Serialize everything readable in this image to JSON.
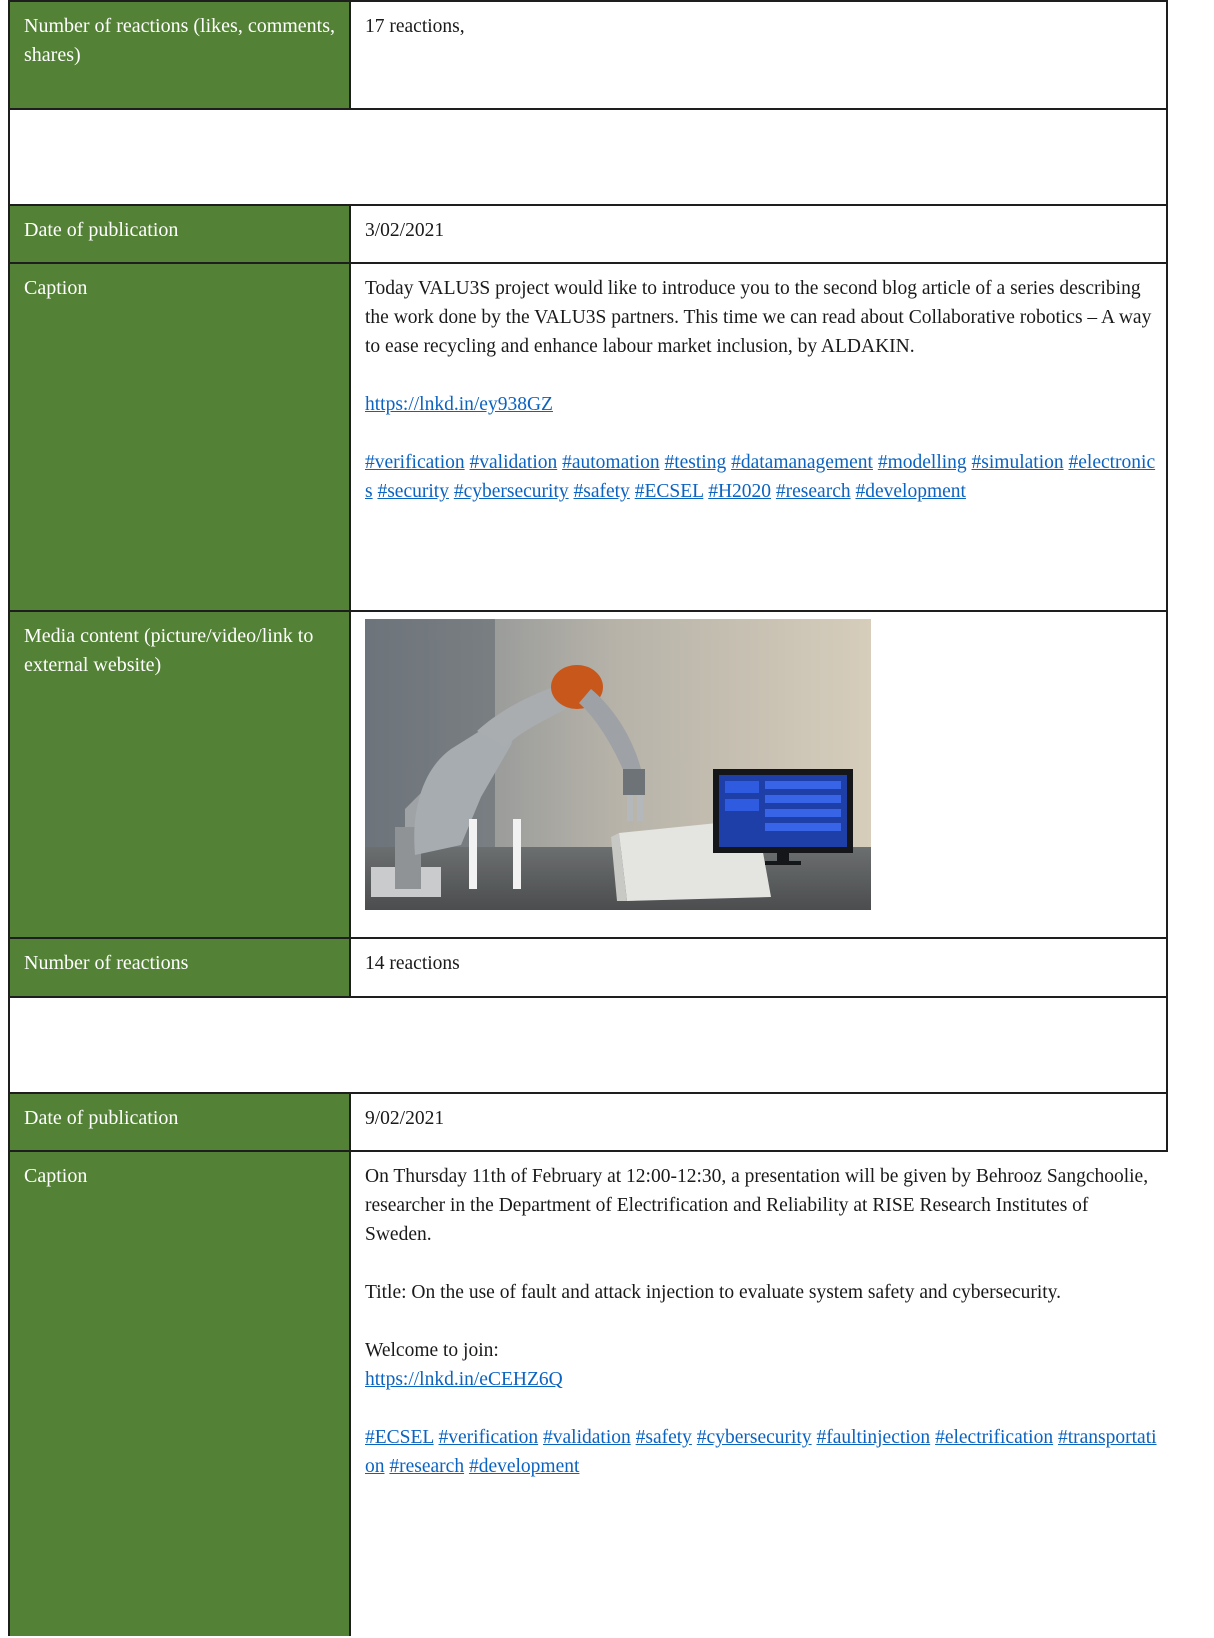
{
  "rows": {
    "r1": {
      "label": "Number of reactions (likes, comments, shares)",
      "value": "17 reactions,"
    },
    "r2": {
      "label": "Date of publication",
      "value": "3/02/2021"
    },
    "r3": {
      "label": "Caption",
      "text": "Today VALU3S project would like to introduce you to the second blog article of a series describing the work done by the VALU3S partners. This time we can read about Collaborative robotics – A way to ease recycling and enhance labour market inclusion, by ALDAKIN.",
      "link": "https://lnkd.in/ey938GZ",
      "tags": [
        "#verification",
        "#validation",
        "#automation",
        "#testing",
        "#datamanagement",
        "#modelling",
        "#simulation",
        "#electronics",
        "#security",
        "#cybersecurity",
        "#safety",
        "#ECSEL",
        "#H2020",
        "#research",
        "#development"
      ]
    },
    "r4": {
      "label": "Media content (picture/video/link to external website)"
    },
    "r5": {
      "label": "Number of reactions",
      "value": "14 reactions"
    },
    "r6": {
      "label": "Date of publication",
      "value": "9/02/2021"
    },
    "r7": {
      "label": "Caption",
      "text1": "On Thursday 11th of February at 12:00-12:30, a presentation will be given by Behrooz Sangchoolie, researcher in the Department of Electrification and Reliability at RISE Research Institutes of Sweden.",
      "text2": "Title: On the use of fault and attack injection to evaluate system safety and cybersecurity.",
      "text3": "Welcome to join:",
      "link": "https://lnkd.in/eCEHZ6Q",
      "tags": [
        "#ECSEL",
        "#verification",
        "#validation",
        "#safety",
        "#cybersecurity",
        "#faultinjection",
        "#electrification",
        "#transportation",
        "#research",
        "#development"
      ]
    }
  },
  "colors": {
    "label_bg": "#538135",
    "link": "#0b63c1"
  }
}
